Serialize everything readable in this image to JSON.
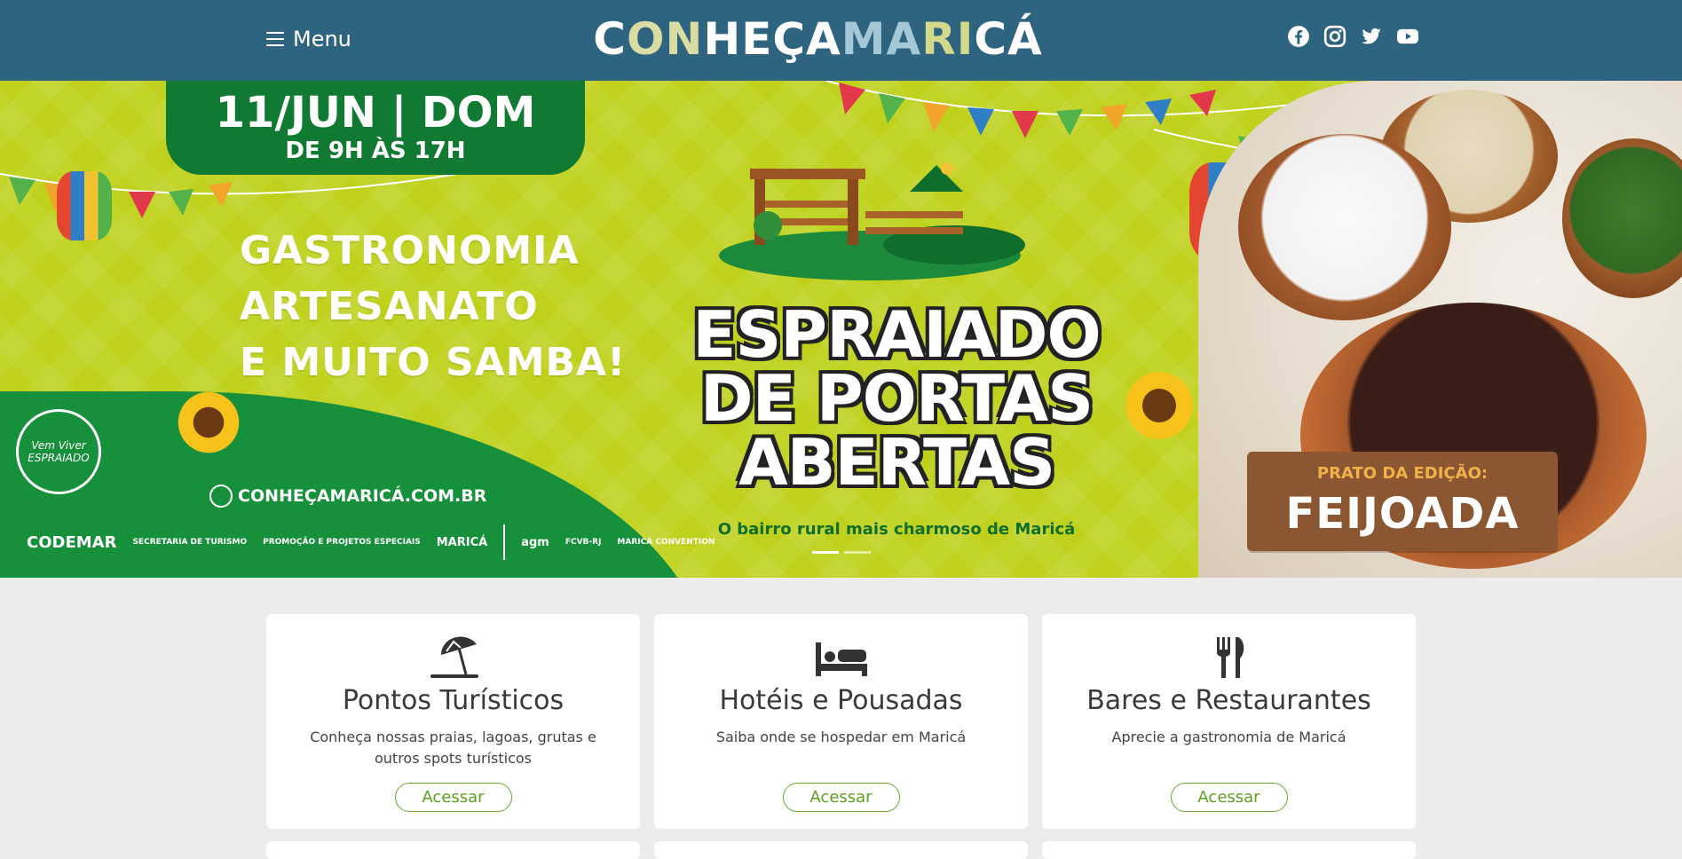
{
  "header": {
    "menu_label": "Menu",
    "logo": {
      "part_1": "C",
      "part_2": "ON",
      "part_3": "HEÇA ",
      "part_4": "MA",
      "part_5": "RI",
      "part_6": "CÁ"
    },
    "social_icons": [
      "facebook-icon",
      "instagram-icon",
      "twitter-icon",
      "youtube-icon"
    ],
    "background_color": "#2f6480"
  },
  "hero": {
    "date_line": "11/JUN | DOM",
    "time_line": "DE 9H ÀS 17H",
    "features": [
      "GASTRONOMIA",
      "ARTESANATO",
      "E MUITO SAMBA!"
    ],
    "event_title_lines": [
      "ESPRAIADO",
      "DE PORTAS",
      "ABERTAS"
    ],
    "event_subtitle": "O bairro rural mais charmoso de Maricá",
    "site_url": "CONHEÇAMARICÁ.COM.BR",
    "badge_text": "Vem Viver ESPRAIADO",
    "dish_label": "PRATO DA EDIÇÃO:",
    "dish_name": "FEIJOADA",
    "partners": [
      "CODEMAR",
      "SECRETARIA DE TURISMO",
      "PROMOÇÃO E PROJETOS ESPECIAIS",
      "MARICÁ",
      "agm",
      "FCVB-RJ",
      "MARICÁ CONVENTION"
    ],
    "slide_count": 2,
    "active_slide": 1,
    "background_color": "#bfd11c"
  },
  "cards": [
    {
      "icon": "beach-umbrella-icon",
      "title": "Pontos Turísticos",
      "description": "Conheça nossas praias, lagoas, grutas e outros spots turísticos",
      "button": "Acessar"
    },
    {
      "icon": "bed-icon",
      "title": "Hotéis e Pousadas",
      "description": "Saiba onde se hospedar em Maricá",
      "button": "Acessar"
    },
    {
      "icon": "fork-knife-icon",
      "title": "Bares e Restaurantes",
      "description": "Aprecie a gastronomia de Maricá",
      "button": "Acessar"
    }
  ],
  "accent_color": "#6aa730"
}
